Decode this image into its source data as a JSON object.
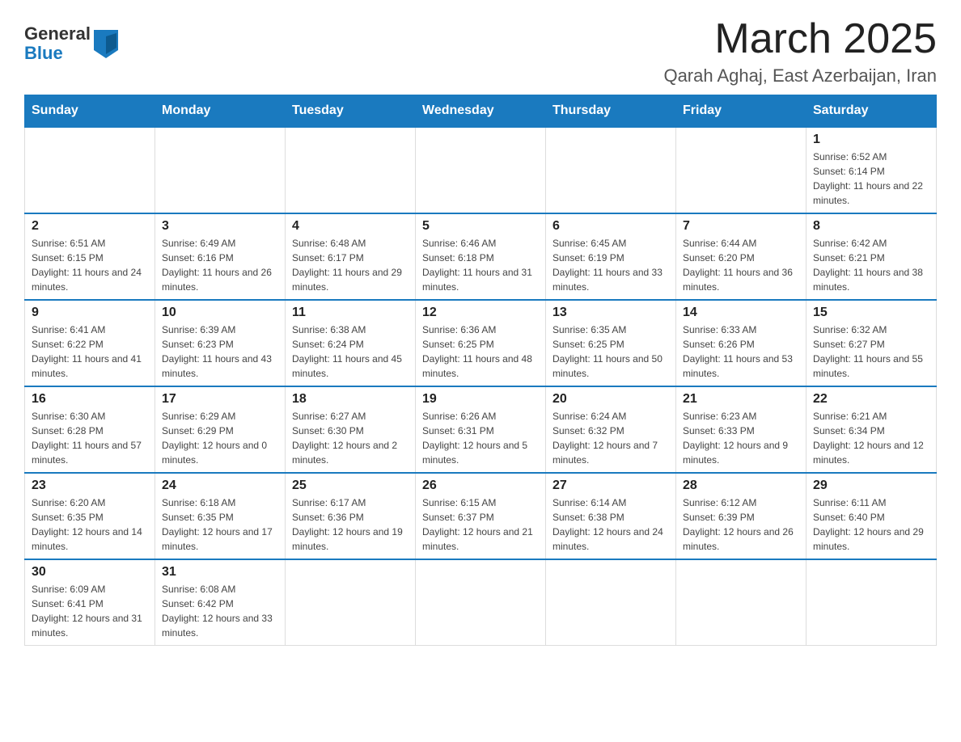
{
  "header": {
    "logo_general": "General",
    "logo_blue": "Blue",
    "month_title": "March 2025",
    "location": "Qarah Aghaj, East Azerbaijan, Iran"
  },
  "days_of_week": [
    "Sunday",
    "Monday",
    "Tuesday",
    "Wednesday",
    "Thursday",
    "Friday",
    "Saturday"
  ],
  "weeks": [
    [
      {
        "day": "",
        "info": ""
      },
      {
        "day": "",
        "info": ""
      },
      {
        "day": "",
        "info": ""
      },
      {
        "day": "",
        "info": ""
      },
      {
        "day": "",
        "info": ""
      },
      {
        "day": "",
        "info": ""
      },
      {
        "day": "1",
        "info": "Sunrise: 6:52 AM\nSunset: 6:14 PM\nDaylight: 11 hours and 22 minutes."
      }
    ],
    [
      {
        "day": "2",
        "info": "Sunrise: 6:51 AM\nSunset: 6:15 PM\nDaylight: 11 hours and 24 minutes."
      },
      {
        "day": "3",
        "info": "Sunrise: 6:49 AM\nSunset: 6:16 PM\nDaylight: 11 hours and 26 minutes."
      },
      {
        "day": "4",
        "info": "Sunrise: 6:48 AM\nSunset: 6:17 PM\nDaylight: 11 hours and 29 minutes."
      },
      {
        "day": "5",
        "info": "Sunrise: 6:46 AM\nSunset: 6:18 PM\nDaylight: 11 hours and 31 minutes."
      },
      {
        "day": "6",
        "info": "Sunrise: 6:45 AM\nSunset: 6:19 PM\nDaylight: 11 hours and 33 minutes."
      },
      {
        "day": "7",
        "info": "Sunrise: 6:44 AM\nSunset: 6:20 PM\nDaylight: 11 hours and 36 minutes."
      },
      {
        "day": "8",
        "info": "Sunrise: 6:42 AM\nSunset: 6:21 PM\nDaylight: 11 hours and 38 minutes."
      }
    ],
    [
      {
        "day": "9",
        "info": "Sunrise: 6:41 AM\nSunset: 6:22 PM\nDaylight: 11 hours and 41 minutes."
      },
      {
        "day": "10",
        "info": "Sunrise: 6:39 AM\nSunset: 6:23 PM\nDaylight: 11 hours and 43 minutes."
      },
      {
        "day": "11",
        "info": "Sunrise: 6:38 AM\nSunset: 6:24 PM\nDaylight: 11 hours and 45 minutes."
      },
      {
        "day": "12",
        "info": "Sunrise: 6:36 AM\nSunset: 6:25 PM\nDaylight: 11 hours and 48 minutes."
      },
      {
        "day": "13",
        "info": "Sunrise: 6:35 AM\nSunset: 6:25 PM\nDaylight: 11 hours and 50 minutes."
      },
      {
        "day": "14",
        "info": "Sunrise: 6:33 AM\nSunset: 6:26 PM\nDaylight: 11 hours and 53 minutes."
      },
      {
        "day": "15",
        "info": "Sunrise: 6:32 AM\nSunset: 6:27 PM\nDaylight: 11 hours and 55 minutes."
      }
    ],
    [
      {
        "day": "16",
        "info": "Sunrise: 6:30 AM\nSunset: 6:28 PM\nDaylight: 11 hours and 57 minutes."
      },
      {
        "day": "17",
        "info": "Sunrise: 6:29 AM\nSunset: 6:29 PM\nDaylight: 12 hours and 0 minutes."
      },
      {
        "day": "18",
        "info": "Sunrise: 6:27 AM\nSunset: 6:30 PM\nDaylight: 12 hours and 2 minutes."
      },
      {
        "day": "19",
        "info": "Sunrise: 6:26 AM\nSunset: 6:31 PM\nDaylight: 12 hours and 5 minutes."
      },
      {
        "day": "20",
        "info": "Sunrise: 6:24 AM\nSunset: 6:32 PM\nDaylight: 12 hours and 7 minutes."
      },
      {
        "day": "21",
        "info": "Sunrise: 6:23 AM\nSunset: 6:33 PM\nDaylight: 12 hours and 9 minutes."
      },
      {
        "day": "22",
        "info": "Sunrise: 6:21 AM\nSunset: 6:34 PM\nDaylight: 12 hours and 12 minutes."
      }
    ],
    [
      {
        "day": "23",
        "info": "Sunrise: 6:20 AM\nSunset: 6:35 PM\nDaylight: 12 hours and 14 minutes."
      },
      {
        "day": "24",
        "info": "Sunrise: 6:18 AM\nSunset: 6:35 PM\nDaylight: 12 hours and 17 minutes."
      },
      {
        "day": "25",
        "info": "Sunrise: 6:17 AM\nSunset: 6:36 PM\nDaylight: 12 hours and 19 minutes."
      },
      {
        "day": "26",
        "info": "Sunrise: 6:15 AM\nSunset: 6:37 PM\nDaylight: 12 hours and 21 minutes."
      },
      {
        "day": "27",
        "info": "Sunrise: 6:14 AM\nSunset: 6:38 PM\nDaylight: 12 hours and 24 minutes."
      },
      {
        "day": "28",
        "info": "Sunrise: 6:12 AM\nSunset: 6:39 PM\nDaylight: 12 hours and 26 minutes."
      },
      {
        "day": "29",
        "info": "Sunrise: 6:11 AM\nSunset: 6:40 PM\nDaylight: 12 hours and 29 minutes."
      }
    ],
    [
      {
        "day": "30",
        "info": "Sunrise: 6:09 AM\nSunset: 6:41 PM\nDaylight: 12 hours and 31 minutes."
      },
      {
        "day": "31",
        "info": "Sunrise: 6:08 AM\nSunset: 6:42 PM\nDaylight: 12 hours and 33 minutes."
      },
      {
        "day": "",
        "info": ""
      },
      {
        "day": "",
        "info": ""
      },
      {
        "day": "",
        "info": ""
      },
      {
        "day": "",
        "info": ""
      },
      {
        "day": "",
        "info": ""
      }
    ]
  ]
}
